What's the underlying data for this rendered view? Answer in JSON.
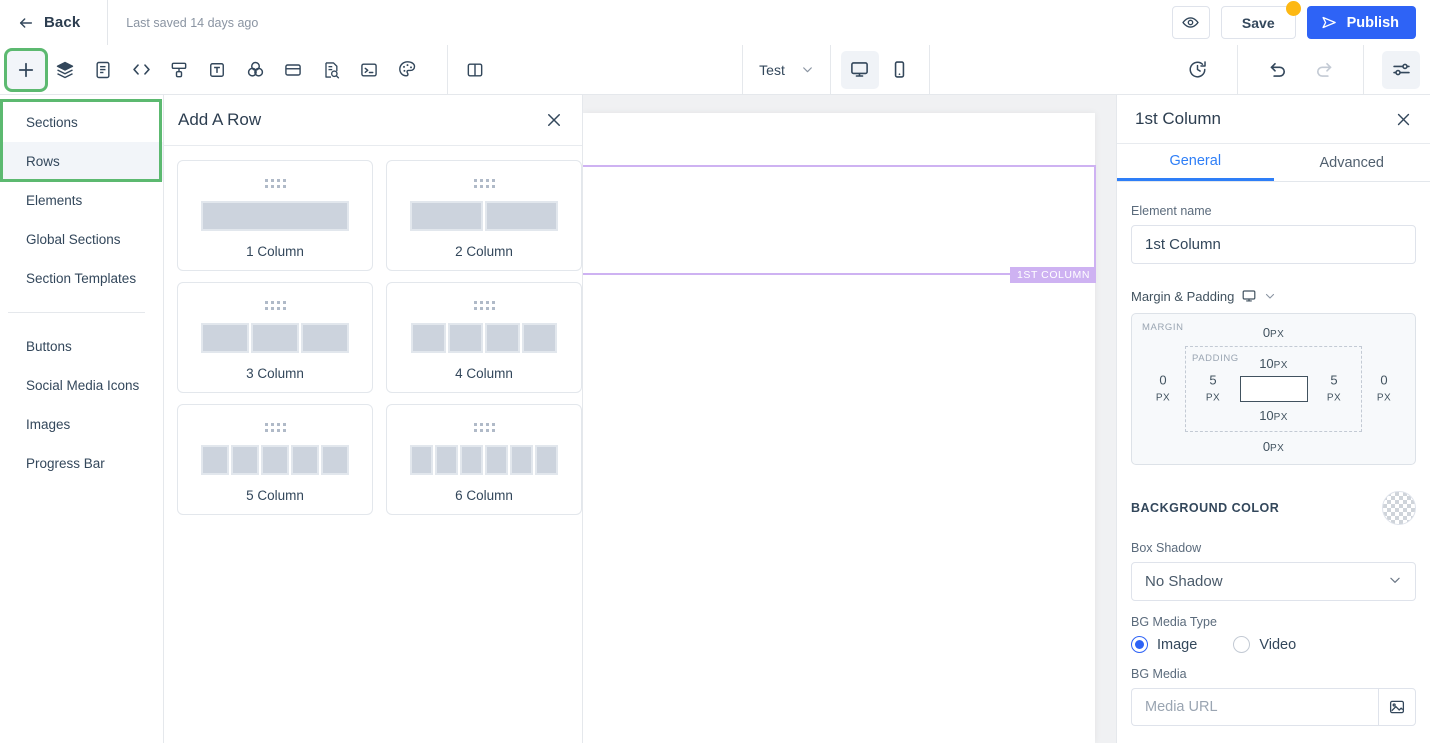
{
  "topbar": {
    "back_label": "Back",
    "saved_text": "Last saved 14 days ago",
    "preview_icon": "eye-icon",
    "save_label": "Save",
    "publish_label": "Publish"
  },
  "toolbar": {
    "tools": [
      {
        "name": "add-icon",
        "title": "Add"
      },
      {
        "name": "layers-icon",
        "title": "Layers"
      },
      {
        "name": "page-icon",
        "title": "Page"
      },
      {
        "name": "code-icon",
        "title": "Code"
      },
      {
        "name": "form-icon",
        "title": "Form"
      },
      {
        "name": "text-icon",
        "title": "Text"
      },
      {
        "name": "theme-icon",
        "title": "Theme"
      },
      {
        "name": "popup-icon",
        "title": "Popup"
      },
      {
        "name": "seo-icon",
        "title": "SEO"
      },
      {
        "name": "terminal-icon",
        "title": "Custom Code"
      },
      {
        "name": "palette-icon",
        "title": "Styles"
      },
      {
        "name": "split-view-icon",
        "title": "Split View"
      }
    ],
    "variant_label": "Test",
    "desktop_icon": "desktop-icon",
    "mobile_icon": "mobile-icon",
    "history_icon": "history-icon",
    "undo_icon": "undo-icon",
    "redo_icon": "redo-icon",
    "settings_icon": "sliders-icon"
  },
  "sidebar": {
    "group1": [
      {
        "label": "Sections",
        "selected": false
      },
      {
        "label": "Rows",
        "selected": true
      },
      {
        "label": "Elements",
        "selected": false
      },
      {
        "label": "Global Sections",
        "selected": false
      },
      {
        "label": "Section Templates",
        "selected": false
      }
    ],
    "group2": [
      {
        "label": "Buttons"
      },
      {
        "label": "Social Media Icons"
      },
      {
        "label": "Images"
      },
      {
        "label": "Progress Bar"
      }
    ],
    "highlight_color": "#5cb970"
  },
  "row_panel": {
    "title": "Add A Row",
    "close_icon": "close-icon",
    "cards": [
      {
        "label": "1 Column",
        "columns": 1
      },
      {
        "label": "2 Column",
        "columns": 2
      },
      {
        "label": "3 Column",
        "columns": 3
      },
      {
        "label": "4 Column",
        "columns": 4
      },
      {
        "label": "5 Column",
        "columns": 5
      },
      {
        "label": "6 Column",
        "columns": 6
      }
    ]
  },
  "canvas": {
    "column_tag": "1ST COLUMN",
    "outline_color": "#ceb2f2"
  },
  "right_panel": {
    "title": "1st Column",
    "close_icon": "close-icon",
    "tabs": [
      {
        "label": "General",
        "active": true
      },
      {
        "label": "Advanced",
        "active": false
      }
    ],
    "element_name": {
      "label": "Element name",
      "value": "1st Column"
    },
    "margin_padding": {
      "label": "Margin & Padding",
      "device_icon": "desktop-icon",
      "margin_tag": "MARGIN",
      "padding_tag": "PADDING",
      "margin_top": "0",
      "margin_top_unit": "PX",
      "margin_right": "0",
      "margin_right_unit": "PX",
      "margin_bottom": "0",
      "margin_bottom_unit": "PX",
      "margin_left": "0",
      "margin_left_unit": "PX",
      "padding_top": "10",
      "padding_top_unit": "PX",
      "padding_right": "5",
      "padding_right_unit": "PX",
      "padding_bottom": "10",
      "padding_bottom_unit": "PX",
      "padding_left": "5",
      "padding_left_unit": "PX"
    },
    "background_color": {
      "label": "BACKGROUND COLOR",
      "swatch": "transparent-checker"
    },
    "box_shadow": {
      "label": "Box Shadow",
      "value": "No Shadow",
      "options": [
        "No Shadow"
      ]
    },
    "bg_media_type": {
      "label": "BG Media Type",
      "options": [
        {
          "label": "Image",
          "selected": true
        },
        {
          "label": "Video",
          "selected": false
        }
      ]
    },
    "bg_media": {
      "label": "BG Media",
      "placeholder": "Media URL",
      "value": "",
      "button_icon": "image-icon"
    }
  },
  "colors": {
    "accent_blue": "#2e63f6",
    "tab_blue": "#2e7ef7",
    "highlight_green": "#5cb970",
    "badge_yellow": "#fdb813",
    "purple_outline": "#ceb2f2"
  }
}
